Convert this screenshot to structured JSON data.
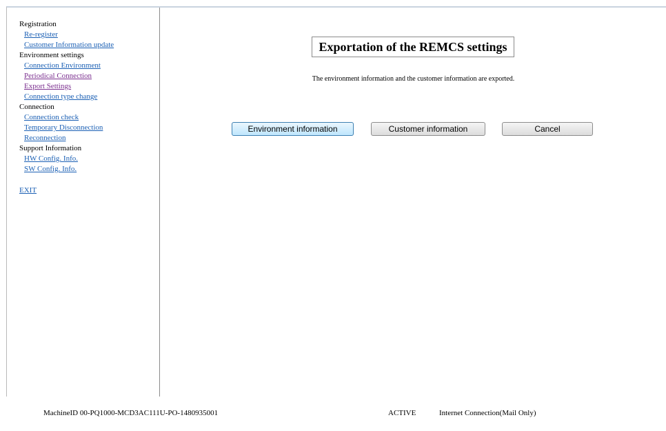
{
  "sidebar": {
    "sections": [
      {
        "heading": "Registration",
        "links": [
          {
            "label": "Re-register"
          },
          {
            "label": "Customer Information update"
          }
        ]
      },
      {
        "heading": "Environment settings",
        "links": [
          {
            "label": "Connection Environment"
          },
          {
            "label": "Periodical Connection",
            "visited": true
          },
          {
            "label": "Export Settings",
            "visited": true
          },
          {
            "label": "Connection type change"
          }
        ]
      },
      {
        "heading": "Connection",
        "links": [
          {
            "label": "Connection check"
          },
          {
            "label": "Temporary Disconnection"
          },
          {
            "label": "Reconnection"
          }
        ]
      },
      {
        "heading": "Support Information",
        "links": [
          {
            "label": "HW Config. Info."
          },
          {
            "label": "SW Config. Info."
          }
        ]
      }
    ],
    "exit_label": "EXIT"
  },
  "main": {
    "title": "Exportation of the REMCS settings",
    "description": "The environment information and the customer information are exported.",
    "buttons": {
      "environment": "Environment information",
      "customer": "Customer information",
      "cancel": "Cancel"
    }
  },
  "status": {
    "machine_id": "MachineID  00-PQ1000-MCD3AC111U-PO-1480935001",
    "state": "ACTIVE",
    "connection": "Internet Connection(Mail Only)"
  }
}
